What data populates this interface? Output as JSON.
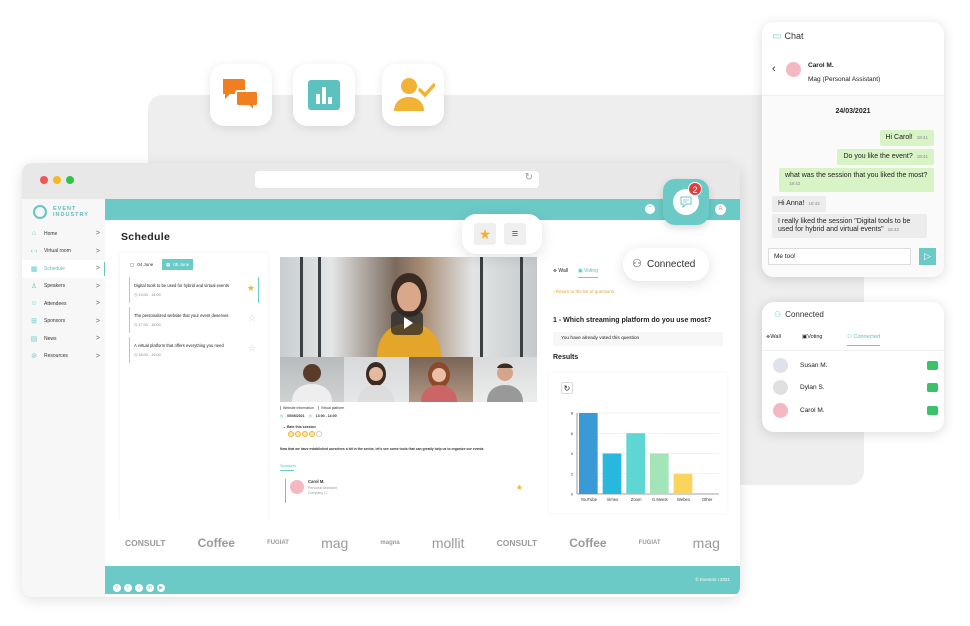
{
  "feature_icons": [
    {
      "name": "chat-bubbles-icon",
      "color": "#f07f22"
    },
    {
      "name": "bar-chart-icon",
      "color": "#5cc2bf"
    },
    {
      "name": "user-check-icon",
      "color": "#f2b233"
    }
  ],
  "browser": {
    "traffic_lights": [
      "#ee5555",
      "#f5b823",
      "#2ec44a"
    ],
    "reload_icon": "↻"
  },
  "app": {
    "accent": "#6ccac6",
    "logo_line1": "EVENT",
    "logo_line2": "INDUSTRY",
    "sidebar": [
      {
        "icon": "⌂",
        "label": "Home",
        "active": false
      },
      {
        "icon": "‹·›",
        "label": "Virtual room",
        "active": false
      },
      {
        "icon": "▦",
        "label": "Schedule",
        "active": true
      },
      {
        "icon": "♙",
        "label": "Speakers",
        "active": false
      },
      {
        "icon": "☺",
        "label": "Attendees",
        "active": false
      },
      {
        "icon": "⊞",
        "label": "Sponsors",
        "active": false
      },
      {
        "icon": "▤",
        "label": "News",
        "active": false
      },
      {
        "icon": "⊘",
        "label": "Resources",
        "active": false
      }
    ],
    "chevron": ">",
    "page_title": "Schedule",
    "date_tabs": [
      {
        "label": "04 June",
        "active": false
      },
      {
        "label": "05 June",
        "active": true
      }
    ],
    "sessions": [
      {
        "title": "Digital tools to be used for hybrid and virtual events",
        "time": "13:00 - 14:00",
        "starred": true
      },
      {
        "title": "The personalized website that your event deserves",
        "time": "17:00 - 18:00",
        "starred": false
      },
      {
        "title": "A virtual platform that offers everything you need",
        "time": "18:00 - 19:00",
        "starred": false
      }
    ],
    "session_detail": {
      "tags": [
        "Website information",
        "Virtual platform"
      ],
      "date": "05/06/2021",
      "time": "13:00 - 14:00",
      "rate_label": "Rate this session",
      "rating": 4,
      "rating_max": 5,
      "description": "Now that we have established ourselves a bit in the sector, let's see some tools that can greatly help us to organize our events",
      "speakers_label": "Speakers",
      "speaker": {
        "name": "Carol M.",
        "role": "Personal Assistant",
        "company": "Company C."
      }
    },
    "poll": {
      "tabs": [
        {
          "label": "Wall",
          "active": false
        },
        {
          "label": "Voting",
          "active": true
        }
      ],
      "back_link": "Return to the list of questions",
      "question": "1 - Which streaming platform do you use most?",
      "voted_notice": "You have already voted this question",
      "results_label": "Results"
    },
    "sponsors": [
      "CONSULT",
      "Coffee",
      "FUGIAT",
      "mag",
      "magna",
      "mollit",
      "CONSULT",
      "Coffee",
      "FUGIAT",
      "mag"
    ],
    "social": [
      "f",
      "t",
      "i",
      "in",
      "▶"
    ],
    "copyright": "© Eventos I 2021"
  },
  "chart_data": {
    "type": "bar",
    "title": "",
    "xlabel": "",
    "ylabel": "",
    "categories": [
      "YouTube",
      "Vimeo",
      "Zoom",
      "G.Meets",
      "Webex",
      "Other"
    ],
    "values": [
      8,
      4,
      6,
      4,
      2,
      0
    ],
    "colors": [
      "#3a9ad6",
      "#29b8dd",
      "#5dd6d4",
      "#a3e4b9",
      "#fad45c",
      "#cccccc"
    ],
    "ylim": [
      0,
      8
    ],
    "yticks": [
      0,
      2,
      4,
      6,
      8
    ],
    "grid": true,
    "legend": "none"
  },
  "toolbar_popup": {
    "items": [
      "star-icon",
      "list-icon"
    ]
  },
  "connected_popup": {
    "label": "Connected"
  },
  "chat_badge": {
    "count": "2"
  },
  "chat": {
    "title": "Chat",
    "contact_name": "Carol M.",
    "contact_role": "Mag (Personal Assistant)",
    "date": "24/03/2021",
    "messages": [
      {
        "from": "me",
        "text": "Hi Carol!",
        "time": "18:41"
      },
      {
        "from": "me",
        "text": "Do you like the event?",
        "time": "18:41"
      },
      {
        "from": "me",
        "text": "what was the session that you liked the most?",
        "time": "18:42"
      },
      {
        "from": "them",
        "text": "Hi Anna!",
        "time": "18:42"
      },
      {
        "from": "them",
        "text": "I really liked the session \"Digital tools to be used for hybrid and virtual events\"",
        "time": "18:43"
      }
    ],
    "input_value": "Me too!"
  },
  "connected": {
    "title": "Connected",
    "tabs": [
      {
        "label": "Wall",
        "active": false
      },
      {
        "label": "Voting",
        "active": false
      },
      {
        "label": "Connected",
        "active": true
      }
    ],
    "users": [
      {
        "name": "Susan M."
      },
      {
        "name": "Dylan S."
      },
      {
        "name": "Carol M."
      }
    ]
  }
}
